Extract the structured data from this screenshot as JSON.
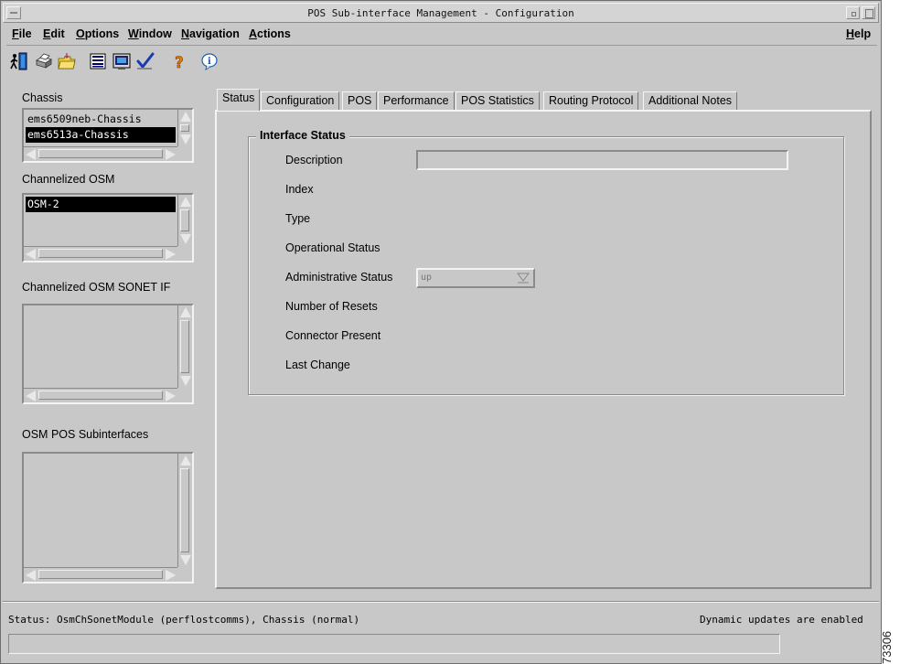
{
  "window": {
    "title": "POS Sub-interface Management - Configuration"
  },
  "menubar": {
    "items": [
      {
        "label": "File",
        "mnemonic": "F",
        "rest": "ile"
      },
      {
        "label": "Edit",
        "mnemonic": "E",
        "rest": "dit"
      },
      {
        "label": "Options",
        "mnemonic": "O",
        "rest": "ptions"
      },
      {
        "label": "Window",
        "mnemonic": "W",
        "rest": "indow"
      },
      {
        "label": "Navigation",
        "mnemonic": "N",
        "rest": "avigation"
      },
      {
        "label": "Actions",
        "mnemonic": "A",
        "rest": "ctions"
      }
    ],
    "help": {
      "label": "Help",
      "mnemonic": "H",
      "rest": "elp"
    }
  },
  "toolbar": {
    "icons": [
      "exit-icon",
      "print-icon",
      "open-folder-icon",
      "list-icon",
      "monitor-icon",
      "checkmark-icon",
      "help-icon",
      "info-icon"
    ]
  },
  "left": {
    "chassis": {
      "label": "Chassis",
      "items": [
        {
          "text": "ems6509neb-Chassis",
          "selected": false
        },
        {
          "text": "ems6513a-Chassis",
          "selected": true
        }
      ]
    },
    "osm": {
      "label": "Channelized OSM",
      "items": [
        {
          "text": "OSM-2",
          "selected": true
        }
      ]
    },
    "sonet": {
      "label": "Channelized OSM SONET IF",
      "items": []
    },
    "subif": {
      "label": "OSM POS Subinterfaces",
      "items": []
    }
  },
  "tabs": [
    {
      "label": "Status",
      "active": true
    },
    {
      "label": "Configuration",
      "active": false
    },
    {
      "label": "POS",
      "active": false
    },
    {
      "label": "Performance",
      "active": false
    },
    {
      "label": "POS Statistics",
      "active": false
    },
    {
      "label": "Routing Protocol",
      "active": false
    },
    {
      "label": "Additional Notes",
      "active": false
    }
  ],
  "status_panel": {
    "group_title": "Interface Status",
    "fields": {
      "description": {
        "label": "Description",
        "value": ""
      },
      "index": {
        "label": "Index"
      },
      "type": {
        "label": "Type"
      },
      "operational": {
        "label": "Operational Status"
      },
      "administrative": {
        "label": "Administrative Status",
        "value": "up"
      },
      "resets": {
        "label": "Number of Resets"
      },
      "connector": {
        "label": "Connector Present"
      },
      "last_change": {
        "label": "Last Change"
      }
    }
  },
  "statusbar": {
    "left": "Status: OsmChSonetModule (perflostcomms), Chassis (normal)",
    "right": "Dynamic updates are enabled"
  },
  "figure_id": "73306",
  "colors": {
    "background": "#c8c8c8",
    "selection": "#000000"
  }
}
